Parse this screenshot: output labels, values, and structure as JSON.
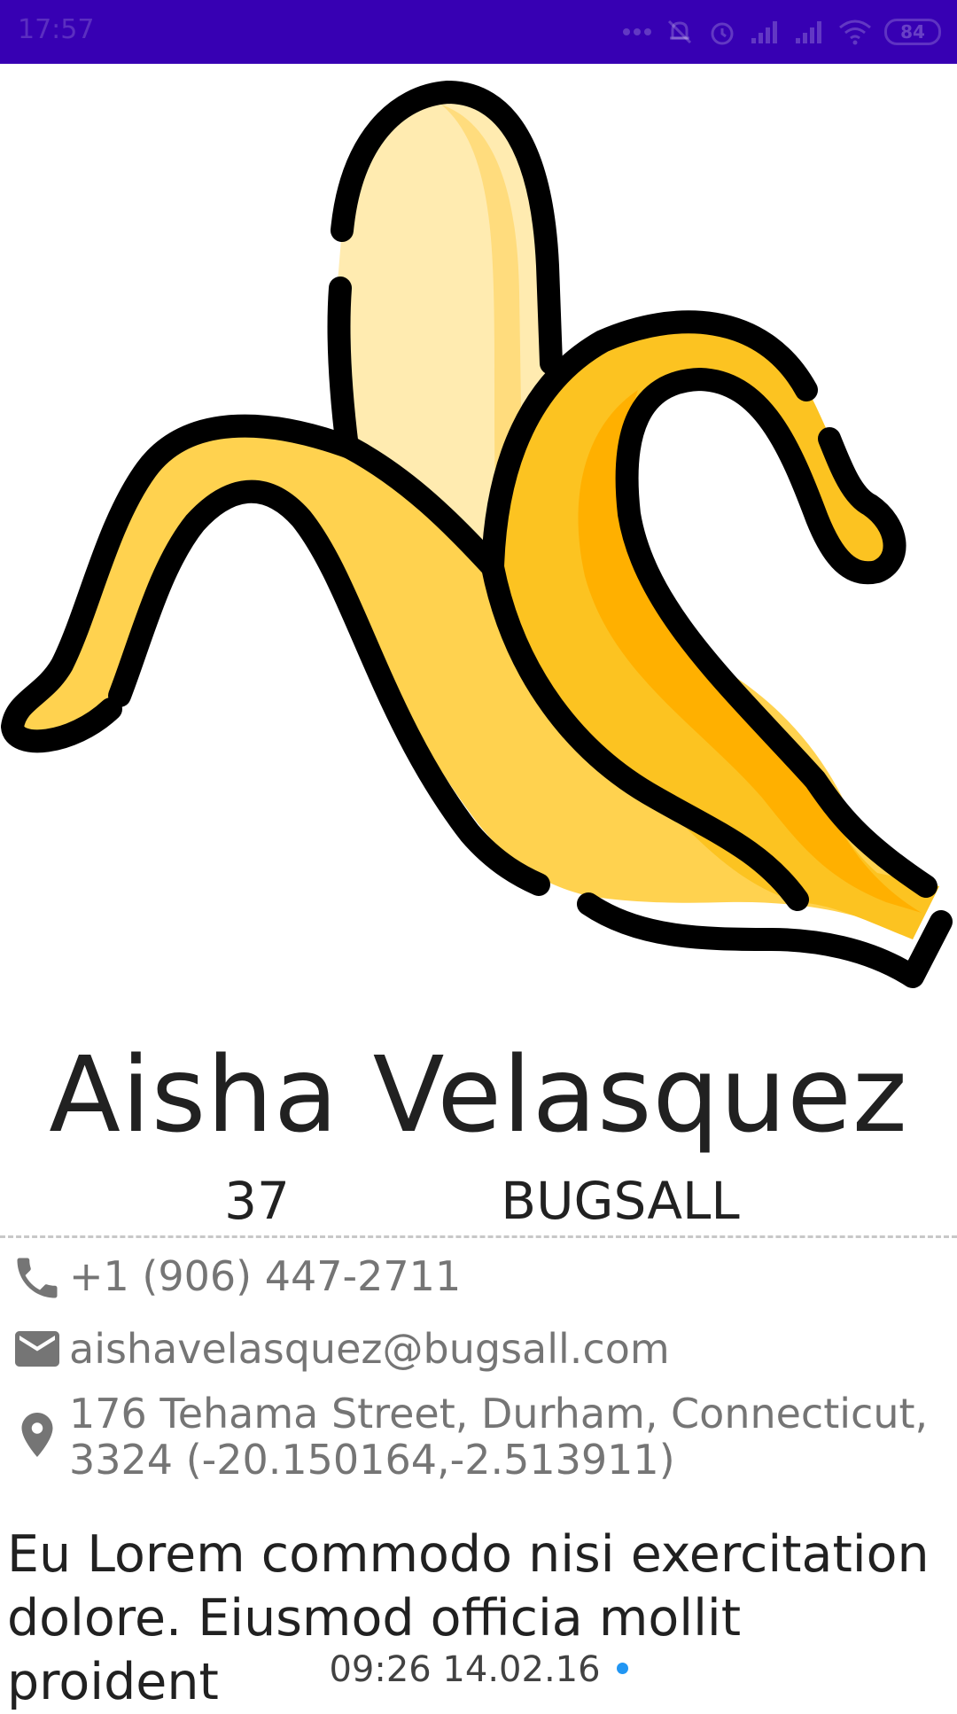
{
  "status_bar": {
    "time": "17:57",
    "battery_level": "84",
    "background_color": "#3700b3",
    "icons": [
      "more-dots-icon",
      "notifications-off-icon",
      "alarm-icon",
      "signal-icon",
      "signal-icon",
      "wifi-icon",
      "battery-icon"
    ]
  },
  "hero": {
    "icon": "peeled-banana-illustration"
  },
  "profile": {
    "name": "Aisha Velasquez",
    "age": "37",
    "company": "BUGSALL",
    "phone": "+1 (906) 447-2711",
    "email": "aishavelasquez@bugsall.com",
    "address": "176 Tehama Street, Durham, Connecticut, 3324 (-20.150164,-2.513911)",
    "about": "Eu Lorem commodo nisi exercitation dolore. Eiusmod officia mollit proident",
    "registered": "09:26 14.02.16",
    "is_active": true,
    "active_color": "#2196f3"
  },
  "icons": {
    "phone": "phone-icon",
    "email": "email-icon",
    "address": "location-pin-icon"
  }
}
